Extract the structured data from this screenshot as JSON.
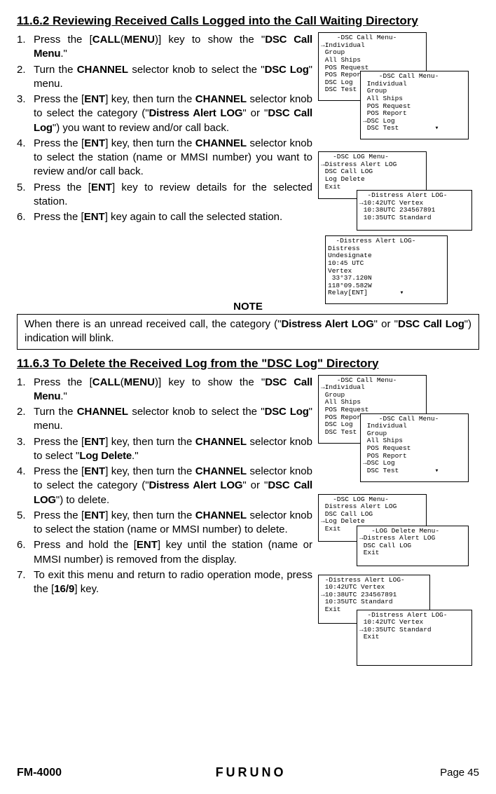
{
  "section1": {
    "heading": "11.6.2  Reviewing Received Calls Logged into the Call Waiting Directory",
    "steps": [
      {
        "num": "1.",
        "pre": "Press the [",
        "k1": "CALL",
        "mid": "(",
        "k2": "MENU",
        "post": ")] key to show the \"",
        "d": "DSC Call Menu",
        "end": ".\""
      },
      {
        "num": "2.",
        "pre": "Turn the ",
        "k1": "CHANNEL",
        "post": " selector knob to select the \"",
        "d": "DSC Log",
        "end": "\" menu."
      },
      {
        "num": "3.",
        "pre": "Press the [",
        "k1": "ENT",
        "post": "] key, then turn the ",
        "k2": "CHANNEL",
        "post2": " selector knob to select the category (\"",
        "d": "Distress Alert LOG",
        "mid2": "\" or \"",
        "d2": "DSC Call Log",
        "end": "\") you want to review and/or call back."
      },
      {
        "num": "4.",
        "pre": "Press the [",
        "k1": "ENT",
        "post": "] key, then turn the ",
        "k2": "CHANNEL",
        "end": " selector knob to select the station (name or MMSI number) you want to review and/or call back."
      },
      {
        "num": "5.",
        "pre": "Press the [",
        "k1": "ENT",
        "end": "] key to review details for the selected station."
      },
      {
        "num": "6.",
        "pre": "Press the [",
        "k1": "ENT",
        "end": "] key again to call the selected station."
      }
    ],
    "screens": {
      "s1": "    -DSC Call Menu-\n→Individual\n Group\n All Ships\n POS Request\n POS Report\n DSC Log\n DSC Test",
      "s2": "    -DSC Call Menu-\n Individual\n Group\n All Ships\n POS Request\n POS Report\n→DSC Log\n DSC Test         ▾",
      "s3": "   -DSC LOG Menu-\n→Distress Alert LOG\n DSC Call LOG\n Log Delete\n Exit",
      "s4": "  -Distress Alert LOG-\n→10:42UTC Vertex\n 10:38UTC 234567891\n 10:35UTC Standard",
      "s5": "  -Distress Alert LOG-\nDistress\nUndesignate\n10:45 UTC\nVertex\n 33°37.120N\n118°09.582W\nRelay[ENT]        ▾"
    }
  },
  "note": {
    "title": "NOTE",
    "pre": "When there is an unread received call, the category (\"",
    "d1": "Distress Alert LOG",
    "mid": "\" or \"",
    "d2": "DSC Call Log",
    "end": "\") indication will blink."
  },
  "section2": {
    "heading": "11.6.3  To Delete the Received Log from the \"DSC Log\" Directory",
    "steps": [
      {
        "num": "1.",
        "pre": "Press the [",
        "k1": "CALL",
        "mid": "(",
        "k2": "MENU",
        "post": ")] key to show the \"",
        "d": "DSC Call Menu",
        "end": ".\""
      },
      {
        "num": "2.",
        "pre": "Turn the ",
        "k1": "CHANNEL",
        "post": " selector knob to select the \"",
        "d": "DSC Log",
        "end": "\" menu."
      },
      {
        "num": "3.",
        "pre": "Press the [",
        "k1": "ENT",
        "post": "] key, then turn the ",
        "k2": "CHANNEL",
        "post2": " selector knob to select \"",
        "d": "Log Delete",
        "end": ".\""
      },
      {
        "num": "4.",
        "pre": "Press the [",
        "k1": "ENT",
        "post": "] key, then turn the ",
        "k2": "CHANNEL",
        "post2": " selector knob to select the category (\"",
        "d": "Distress Alert LOG",
        "mid2": "\" or \"",
        "d2": "DSC Call LOG",
        "end": "\") to delete."
      },
      {
        "num": "5.",
        "pre": "Press the [",
        "k1": "ENT",
        "post": "] key, then turn the ",
        "k2": "CHANNEL",
        "end": " selector knob to select the station (name or MMSI  number) to delete."
      },
      {
        "num": "6.",
        "pre": "Press and hold the [",
        "k1": "ENT",
        "end": "] key until the station (name or MMSI  number) is removed from the display."
      },
      {
        "num": "7.",
        "pre": "To exit this menu and return to radio operation mode, press the [",
        "k1": "16/9",
        "end": "] key."
      }
    ],
    "screens": {
      "s1": "    -DSC Call Menu-\n→Individual\n Group\n All Ships\n POS Request\n POS Report\n DSC Log\n DSC Test",
      "s2": "    -DSC Call Menu-\n Individual\n Group\n All Ships\n POS Request\n POS Report\n→DSC Log\n DSC Test         ▾",
      "s3": "   -DSC LOG Menu-\n Distress Alert LOG\n DSC Call LOG\n→Log Delete\n Exit",
      "s4": "   -LOG Delete Menu-\n→Distress Alert LOG\n DSC Call LOG\n Exit",
      "s5": " -Distress Alert LOG-\n 10:42UTC Vertex\n→10:38UTC 234567891\n 10:35UTC Standard\n Exit",
      "s6": "  -Distress Alert LOG-\n 10:42UTC Vertex\n→10:35UTC Standard\n Exit"
    }
  },
  "footer": {
    "model": "FM-4000",
    "brand": "FURUNO",
    "page": "Page 45"
  }
}
